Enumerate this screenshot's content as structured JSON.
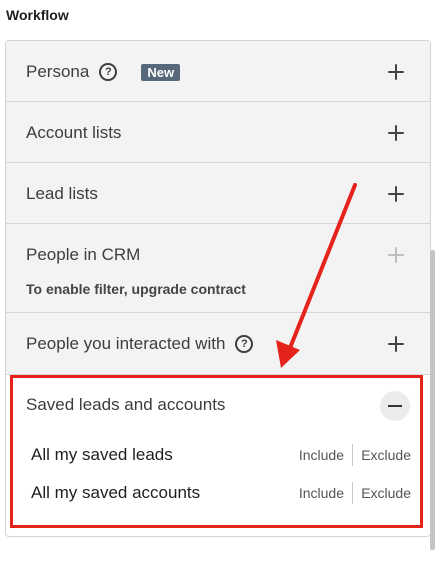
{
  "section": {
    "title": "Workflow"
  },
  "filters": {
    "persona": {
      "label": "Persona",
      "badge": "New",
      "help_icon": "question-circle-icon",
      "action_icon": "plus-icon"
    },
    "account_lists": {
      "label": "Account lists",
      "action_icon": "plus-icon"
    },
    "lead_lists": {
      "label": "Lead lists",
      "action_icon": "plus-icon"
    },
    "people_in_crm": {
      "label": "People in CRM",
      "note": "To enable filter, upgrade contract",
      "action_icon": "plus-icon",
      "disabled": true
    },
    "people_interacted": {
      "label": "People you interacted with",
      "help_icon": "question-circle-icon",
      "action_icon": "plus-icon"
    },
    "saved_leads_accounts": {
      "label": "Saved leads and accounts",
      "action_icon": "minus-icon",
      "expanded": true,
      "items": [
        {
          "name": "All my saved leads",
          "include": "Include",
          "exclude": "Exclude"
        },
        {
          "name": "All my saved accounts",
          "include": "Include",
          "exclude": "Exclude"
        }
      ]
    }
  },
  "annotation": {
    "color": "#e5231b"
  }
}
